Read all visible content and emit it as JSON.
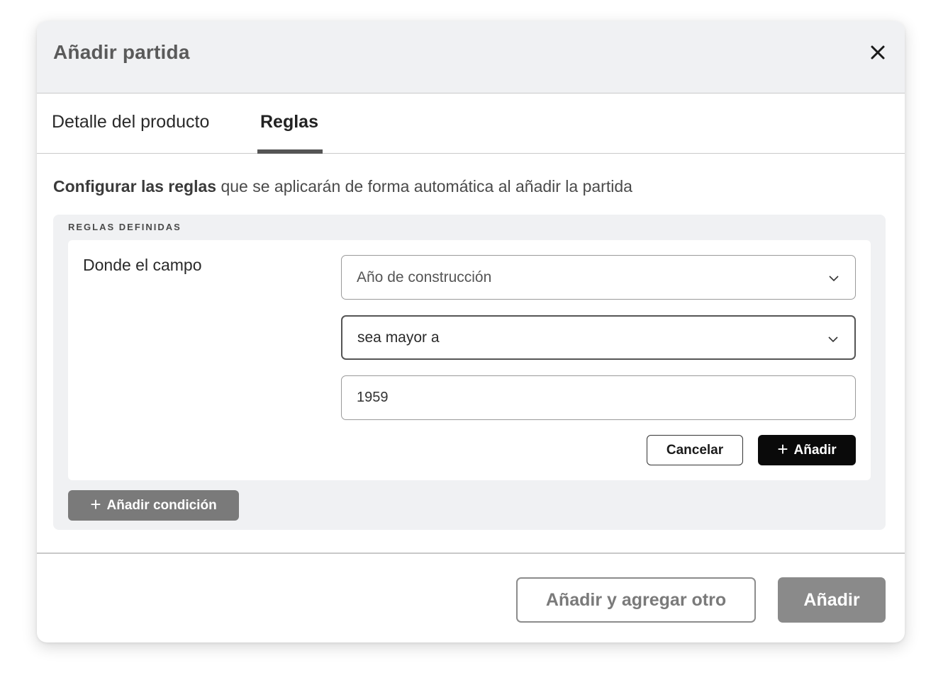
{
  "dialog": {
    "title": "Añadir partida",
    "close_icon": "close-icon"
  },
  "tabs": [
    {
      "label": "Detalle del producto",
      "active": false
    },
    {
      "label": "Reglas",
      "active": true
    }
  ],
  "description": {
    "bold": "Configurar las reglas",
    "rest": " que se aplicarán de forma automática al añadir la partida"
  },
  "rules": {
    "section_label": "REGLAS DEFINIDAS",
    "where_label": "Donde el campo",
    "field_select": {
      "value": "Año de construcción",
      "icon": "chevron-down-icon"
    },
    "operator_select": {
      "value": "sea mayor a",
      "icon": "chevron-down-icon"
    },
    "value_input": {
      "value": "1959"
    },
    "cancel_label": "Cancelar",
    "add_label": "Añadir",
    "add_condition_label": "Añadir condición"
  },
  "footer": {
    "add_another_label": "Añadir y agregar otro",
    "add_label": "Añadir"
  },
  "colors": {
    "header_bg": "#f0f1f3",
    "primary_dark": "#0a0a0a",
    "disabled_button": "#8a8a8a"
  }
}
